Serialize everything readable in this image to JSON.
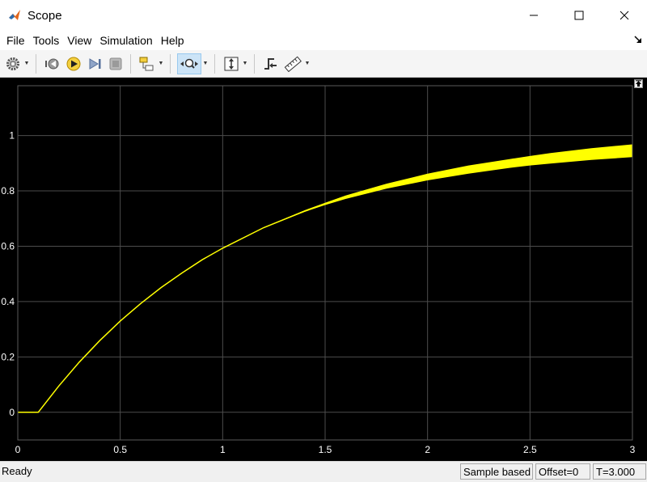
{
  "window": {
    "title": "Scope",
    "controls": [
      "minimize",
      "maximize",
      "close"
    ]
  },
  "menu": {
    "items": [
      {
        "label": "File"
      },
      {
        "label": "Tools"
      },
      {
        "label": "View"
      },
      {
        "label": "Simulation"
      },
      {
        "label": "Help"
      }
    ]
  },
  "toolbar": {
    "buttons": [
      {
        "icon": "settings-gear-icon"
      },
      {
        "icon": "step-back-icon"
      },
      {
        "icon": "run-icon"
      },
      {
        "icon": "step-forward-icon"
      },
      {
        "icon": "stop-icon"
      },
      {
        "icon": "highlight-block-icon"
      },
      {
        "icon": "zoom-icon",
        "active": true
      },
      {
        "icon": "scale-axes-icon"
      },
      {
        "icon": "triggers-icon"
      },
      {
        "icon": "measurements-icon"
      }
    ]
  },
  "chart_data": {
    "type": "line",
    "background": "#000000",
    "grid": true,
    "grid_color": "#4d4d4d",
    "xlim": [
      0,
      3
    ],
    "ylim": [
      -0.1,
      1.18
    ],
    "x_ticks": [
      0,
      0.5,
      1,
      1.5,
      2,
      2.5,
      3
    ],
    "x_tick_labels": [
      "0",
      "0.5",
      "1",
      "1.5",
      "2",
      "2.5",
      "3"
    ],
    "y_ticks": [
      0,
      0.2,
      0.4,
      0.6,
      0.8,
      1
    ],
    "y_tick_labels": [
      "0",
      "0.2",
      "0.4",
      "0.6",
      "0.8",
      "1"
    ],
    "tick_label_color": "#ffffff",
    "series": [
      {
        "color": "#ffff00",
        "x": [
          0,
          0.1,
          0.2,
          0.3,
          0.4,
          0.5,
          0.6,
          0.7,
          0.8,
          0.9,
          1.0,
          1.2,
          1.4,
          1.5,
          1.6,
          1.8,
          2.0,
          2.2,
          2.4,
          2.5,
          2.6,
          2.8,
          3.0
        ],
        "y": [
          0,
          0,
          0.095,
          0.181,
          0.259,
          0.33,
          0.393,
          0.451,
          0.503,
          0.551,
          0.593,
          0.667,
          0.727,
          0.753,
          0.777,
          0.817,
          0.85,
          0.877,
          0.899,
          0.909,
          0.918,
          0.933,
          0.945
        ],
        "y_min": [
          0,
          0,
          0.095,
          0.181,
          0.259,
          0.33,
          0.393,
          0.451,
          0.503,
          0.551,
          0.593,
          0.666,
          0.724,
          0.749,
          0.771,
          0.808,
          0.838,
          0.862,
          0.883,
          0.892,
          0.899,
          0.912,
          0.922
        ],
        "y_max": [
          0,
          0,
          0.095,
          0.181,
          0.259,
          0.33,
          0.393,
          0.451,
          0.503,
          0.551,
          0.593,
          0.668,
          0.73,
          0.757,
          0.783,
          0.826,
          0.862,
          0.892,
          0.915,
          0.926,
          0.937,
          0.954,
          0.968
        ]
      }
    ]
  },
  "status": {
    "ready": "Ready",
    "sample_mode": "Sample based",
    "offset": "Offset=0",
    "time": "T=3.000"
  }
}
